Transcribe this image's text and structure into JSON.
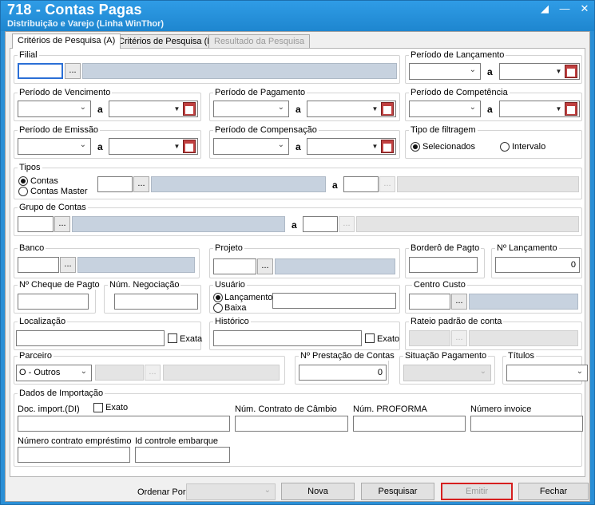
{
  "window": {
    "title": "718 - Contas Pagas",
    "subtitle": "Distribuição e Varejo (Linha WinThor)"
  },
  "tabs": [
    {
      "label": "Critérios de Pesquisa (A)",
      "active": true
    },
    {
      "label": "Critérios de Pesquisa (B)",
      "active": false
    },
    {
      "label": "Resultado da Pesquisa",
      "disabled": true
    }
  ],
  "common": {
    "a": "a",
    "dots": "...",
    "exata": "Exata",
    "exato": "Exato"
  },
  "form": {
    "filial": "Filial",
    "periodo_lancamento": "Período de Lançamento",
    "periodo_vencimento": "Período de Vencimento",
    "periodo_pagamento": "Período de Pagamento",
    "periodo_competencia": "Período de Competência",
    "periodo_emissao": "Período de Emissão",
    "periodo_compensacao": "Período de Compensação",
    "tipo_filtragem": {
      "label": "Tipo de filtragem",
      "options": [
        "Selecionados",
        "Intervalo"
      ]
    },
    "tipos": {
      "label": "Tipos",
      "options": [
        "Contas",
        "Contas Master"
      ]
    },
    "grupo_contas": "Grupo de Contas",
    "banco": "Banco",
    "projeto": "Projeto",
    "bordero": "Borderô de Pagto",
    "num_lancamento": {
      "label": "Nº Lançamento",
      "value": "0"
    },
    "cheque": "Nº Cheque de Pagto",
    "negociacao": "Núm. Negociação",
    "usuario": {
      "label": "Usuário",
      "options": [
        "Lançamento",
        "Baixa"
      ]
    },
    "centro_custo": "Centro Custo",
    "localizacao": "Localização",
    "historico": "Histórico",
    "rateio": "Rateio padrão de conta",
    "parceiro": {
      "label": "Parceiro",
      "value": "O - Outros"
    },
    "prestacao": {
      "label": "Nº Prestação de Contas",
      "value": "0"
    },
    "situacao_pagamento": "Situação Pagamento",
    "titulos": "Títulos",
    "importacao": {
      "label": "Dados de Importação",
      "doc": "Doc. import.(DI)",
      "contrato_cambio": "Núm. Contrato de Câmbio",
      "proforma": "Núm. PROFORMA",
      "invoice": "Número invoice",
      "contrato_emprestimo": "Número contrato empréstimo",
      "controle_embarque": "Id controle embarque"
    }
  },
  "footer": {
    "ordenar_por": "Ordenar Por:",
    "buttons": {
      "nova": "Nova",
      "pesquisar": "Pesquisar",
      "emitir": "Emitir",
      "fechar": "Fechar"
    }
  }
}
